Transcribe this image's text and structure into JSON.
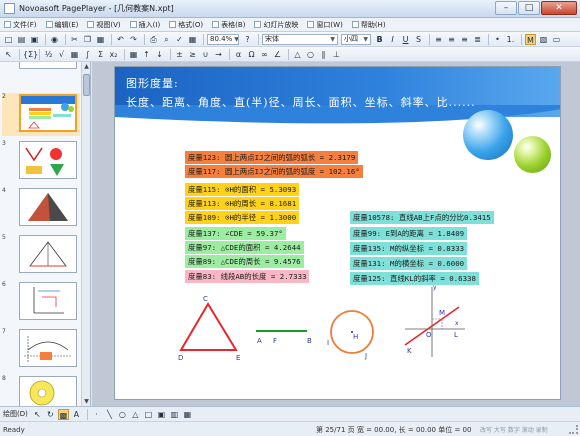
{
  "window": {
    "title": "Novoasoft PagePlayer - [几何教案N.xpt]",
    "minimize": "–",
    "maximize": "□",
    "close": "✕"
  },
  "menu": [
    {
      "label": "文件(F)"
    },
    {
      "label": "编辑(E)"
    },
    {
      "label": "视图(V)"
    },
    {
      "label": "插入(I)"
    },
    {
      "label": "格式(O)"
    },
    {
      "label": "表格(B)"
    },
    {
      "label": "幻灯片放映"
    },
    {
      "label": "窗口(W)"
    },
    {
      "label": "帮助(H)"
    }
  ],
  "toolbar": {
    "zoom": "80.4%",
    "font": "宋体",
    "size": "小四",
    "bold": "B",
    "italic": "I",
    "underline": "U",
    "shadow": "S",
    "left": "A"
  },
  "thumbnails": [
    {
      "number": "1"
    },
    {
      "number": "2"
    },
    {
      "number": "3"
    },
    {
      "number": "4"
    },
    {
      "number": "5"
    },
    {
      "number": "6"
    },
    {
      "number": "7"
    },
    {
      "number": "8"
    }
  ],
  "slide": {
    "header_line1": "图形度量:",
    "header_line2": "长度、距离、角度、直(半)径、周长、面积、坐标、斜率、比......",
    "measurements_left": [
      {
        "text": "度量123: 圆上两点IJ之间的弧的弧长 = 2.3179",
        "color": "#f5803e"
      },
      {
        "text": "度量117: 圆上两点IJ之间的弧的弧度 = 102.16°",
        "color": "#f5803e"
      },
      {
        "text": "度量115: ⊙H的面积 = 5.3093",
        "color": "#ffd21a"
      },
      {
        "text": "度量113: ⊙H的周长 = 8.1681",
        "color": "#ffd21a"
      },
      {
        "text": "度量109: ⊙H的半径 = 1.3000",
        "color": "#ffd21a"
      },
      {
        "text": "度量137: ∠CDE = 59.37°",
        "color": "#9ceda2"
      },
      {
        "text": "度量97: △CDE的面积 = 4.2644",
        "color": "#9ceda2"
      },
      {
        "text": "度量89: △CDE的周长 = 9.4576",
        "color": "#9ceda2"
      },
      {
        "text": "度量83: 线段AB的长度 = 2.7333",
        "color": "#f7b7c4"
      }
    ],
    "measurements_right": [
      {
        "text": "度量10578: 直线AB上F点的分比0.3415",
        "color": "#7ee0d8"
      },
      {
        "text": "度量99: E到A的距离 = 1.8409",
        "color": "#7ee0d8"
      },
      {
        "text": "度量135: M的纵坐标 = 0.8333",
        "color": "#7ee0d8"
      },
      {
        "text": "度量131: M的横坐标 = 0.6000",
        "color": "#7ee0d8"
      },
      {
        "text": "度量125: 直线KL的斜率 = 0.6338",
        "color": "#7ee0d8"
      }
    ],
    "figure_labels": {
      "C": "C",
      "D": "D",
      "E": "E",
      "A": "A",
      "F": "F",
      "B": "B",
      "H": "H",
      "I": "I",
      "J": "J",
      "M": "M",
      "O": "O",
      "K": "K",
      "L": "L",
      "x": "x",
      "y": "y"
    }
  },
  "drawbar": {
    "label": "绘图(D)"
  },
  "status": {
    "left": "Ready",
    "page": "第 25/71 页  宽 = 00.00, 长 = 00.00 单位 = 00",
    "modes": "改写  大写  数字  滚动  录制"
  }
}
